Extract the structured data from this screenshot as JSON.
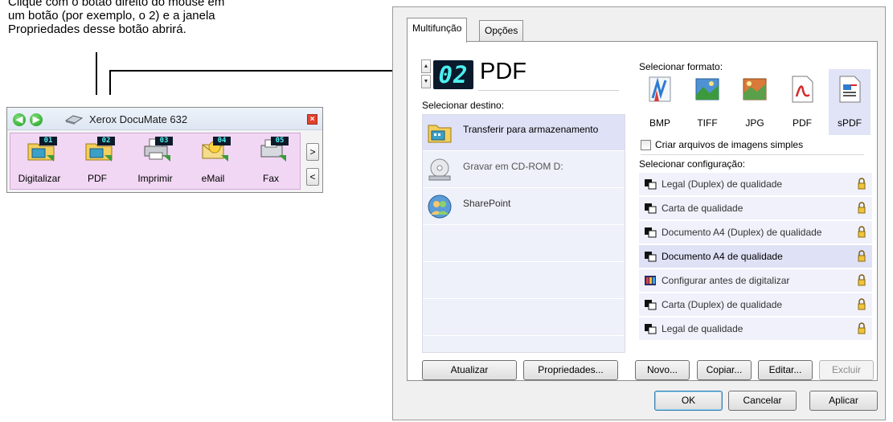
{
  "caption": {
    "line1": "Clique com o botão direito do mouse em",
    "line2": "um botão (por exemplo, o 2) e a janela",
    "line3": "Propriedades desse botão abrirá."
  },
  "toolbar": {
    "title": "Xerox DocuMate 632",
    "back_icon": "arrow-left-icon",
    "forward_icon": "arrow-right-icon",
    "close_label": "×",
    "next_label": ">",
    "prev_label": "<",
    "buttons": [
      {
        "number": "01",
        "label": "Digitalizar"
      },
      {
        "number": "02",
        "label": "PDF"
      },
      {
        "number": "03",
        "label": "Imprimir"
      },
      {
        "number": "04",
        "label": "eMail"
      },
      {
        "number": "05",
        "label": "Fax"
      }
    ]
  },
  "dialog": {
    "tabs": [
      {
        "label": "Multifunção",
        "active": true
      },
      {
        "label": "Opções",
        "active": false
      }
    ],
    "button_number": "02",
    "button_name": "PDF",
    "select_destination_label": "Selecionar destino:",
    "destinations": [
      {
        "label": "Transferir para armazenamento",
        "selected": true
      },
      {
        "label": "Gravar em CD-ROM  D:",
        "selected": false
      },
      {
        "label": "SharePoint",
        "selected": false
      }
    ],
    "select_format_label": "Selecionar formato:",
    "formats": [
      {
        "label": "BMP",
        "selected": false
      },
      {
        "label": "TIFF",
        "selected": false
      },
      {
        "label": "JPG",
        "selected": false
      },
      {
        "label": "PDF",
        "selected": false
      },
      {
        "label": "sPDF",
        "selected": true
      }
    ],
    "single_image_checkbox": {
      "label": "Criar arquivos de imagens simples",
      "checked": false
    },
    "select_config_label": "Selecionar configuração:",
    "configurations": [
      {
        "label": "Legal (Duplex) de qualidade",
        "selected": false
      },
      {
        "label": "Carta de qualidade",
        "selected": false
      },
      {
        "label": "Documento A4 (Duplex) de qualidade",
        "selected": false
      },
      {
        "label": "Documento A4 de qualidade",
        "selected": true
      },
      {
        "label": "Configurar antes de digitalizar",
        "selected": false
      },
      {
        "label": "Carta (Duplex) de qualidade",
        "selected": false
      },
      {
        "label": "Legal de qualidade",
        "selected": false
      }
    ],
    "buttons": {
      "refresh": "Atualizar",
      "properties": "Propriedades...",
      "new": "Novo...",
      "copy": "Copiar...",
      "edit": "Editar...",
      "delete": "Excluir",
      "ok": "OK",
      "cancel": "Cancelar",
      "apply": "Aplicar"
    }
  },
  "colors": {
    "led_background": "#0a1a2c",
    "led_text": "#4cf0f0",
    "toolbar_buttons_bg": "#f1d7f4",
    "selection_bg": "#dfe1f6"
  }
}
